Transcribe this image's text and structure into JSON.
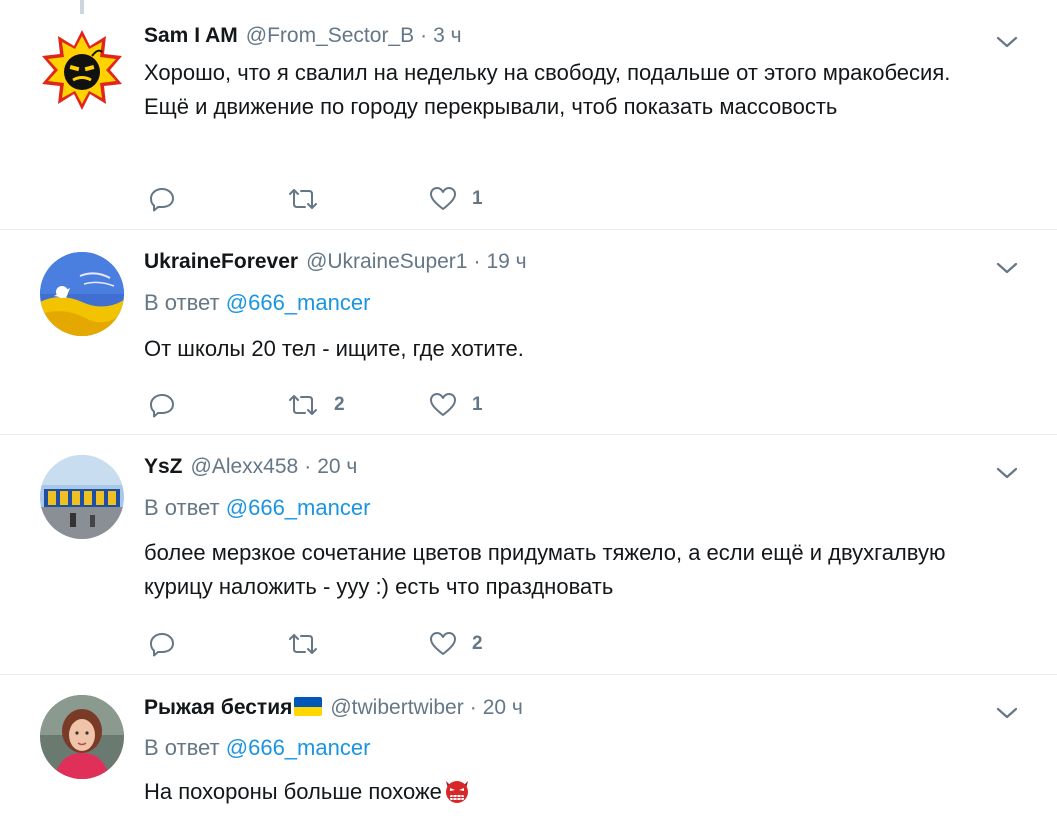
{
  "tweets": [
    {
      "name": "Sam I AM",
      "handle": "@From_Sector_B",
      "separator": "·",
      "time": "3 ч",
      "reply_label": "",
      "reply_mention": "",
      "text": "Хорошо, что я свалил на недельку на свободу, подальше от этого мракобесия. Ещё и движение по городу перекрывали, чтоб показать массовость",
      "reply_count": "",
      "retweet_count": "",
      "like_count": "1"
    },
    {
      "name": "UkraineForever",
      "handle": "@UkraineSuper1",
      "separator": "·",
      "time": "19 ч",
      "reply_label": "В ответ",
      "reply_mention": "@666_mancer",
      "text": "От школы 20 тел - ищите, где хотите.",
      "reply_count": "",
      "retweet_count": "2",
      "like_count": "1"
    },
    {
      "name": "YsZ",
      "handle": "@Alexx458",
      "separator": "·",
      "time": "20 ч",
      "reply_label": "В ответ",
      "reply_mention": "@666_mancer",
      "text": "более мерзкое сочетание цветов придумать тяжело, а если ещё и двухгалвую курицу наложить - ууу :) есть что праздновать",
      "reply_count": "",
      "retweet_count": "",
      "like_count": "2"
    },
    {
      "name": "Рыжая бестия",
      "handle": "@twibertwiber",
      "separator": "·",
      "time": "20 ч",
      "reply_label": "В ответ",
      "reply_mention": "@666_mancer",
      "text": "На похороны больше похоже",
      "reply_count": "",
      "retweet_count": "",
      "like_count": ""
    }
  ],
  "icons": {
    "reply": "reply-icon",
    "retweet": "retweet-icon",
    "like": "heart-icon",
    "caret": "chevron-down-icon",
    "flag": "ukraine-flag-emoji",
    "devil": "devil-emoji"
  },
  "colors": {
    "text": "#14171a",
    "secondary": "#657786",
    "mention": "#1b95e0",
    "divider": "#e6ecf0"
  }
}
